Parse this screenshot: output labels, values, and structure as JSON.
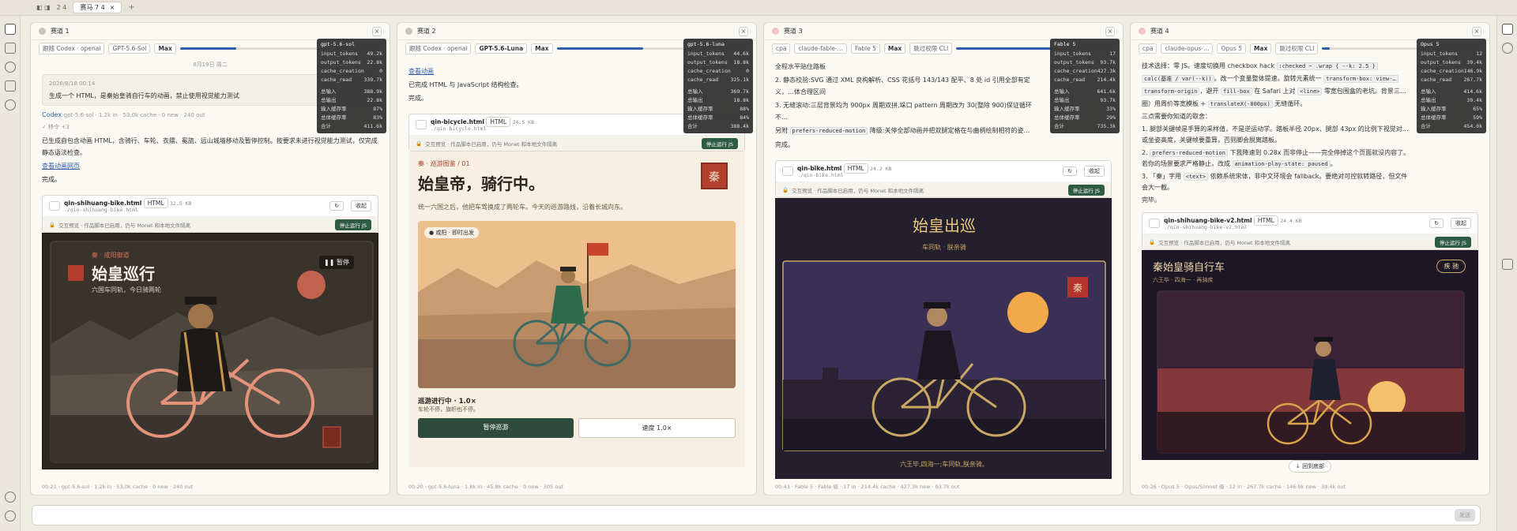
{
  "tabs": {
    "items": [
      "2 4"
    ],
    "active": "赛马 7 4"
  },
  "panels": [
    {
      "title": "赛道 1",
      "chips": [
        "跟随 Codex · openai",
        "GPT-5.6-Sol",
        "Max"
      ],
      "progress": 0.28,
      "stats": {
        "model": "gpt-5.6-sol",
        "rows": [
          [
            "input_tokens",
            "49.2k"
          ],
          [
            "output_tokens",
            "22.8k"
          ],
          [
            "cache_creation",
            "0"
          ],
          [
            "cache_read",
            "339.7k"
          ]
        ],
        "rows2": [
          [
            "总输入",
            "388.9k"
          ],
          [
            "总输出",
            "22.8k"
          ],
          [
            "输入缓存率",
            "87%"
          ],
          [
            "总体缓存率",
            "83%"
          ],
          [
            "合计",
            "411.6k"
          ]
        ]
      }
    },
    {
      "title": "赛道 2",
      "chips": [
        "跟随 Codex · openai",
        "GPT-5.6-Luna",
        "Max"
      ],
      "progress": 0.45,
      "stats": {
        "model": "gpt-5.6-luna",
        "rows": [
          [
            "input_tokens",
            "44.6k"
          ],
          [
            "output_tokens",
            "18.8k"
          ],
          [
            "cache_creation",
            "0"
          ],
          [
            "cache_read",
            "325.1k"
          ]
        ],
        "rows2": [
          [
            "总输入",
            "369.7k"
          ],
          [
            "总输出",
            "18.8k"
          ],
          [
            "输入缓存率",
            "88%"
          ],
          [
            "总体缓存率",
            "84%"
          ],
          [
            "合计",
            "388.4k"
          ]
        ]
      }
    },
    {
      "title": "赛道 3",
      "chips": [
        "cpa",
        "claude-fable-…",
        "Fable 5",
        "Max",
        "跳过权限 CLI"
      ],
      "progress": 0.6,
      "stats": {
        "model": "Fable 5",
        "rows": [
          [
            "input_tokens",
            "17"
          ],
          [
            "output_tokens",
            "93.7k"
          ],
          [
            "cache_creation",
            "427.3k"
          ],
          [
            "cache_read",
            "214.4k"
          ]
        ],
        "rows2": [
          [
            "总输入",
            "641.6k"
          ],
          [
            "总输出",
            "93.7k"
          ],
          [
            "输入缓存率",
            "33%"
          ],
          [
            "总体缓存率",
            "29%"
          ],
          [
            "合计",
            "735.3k"
          ]
        ]
      }
    },
    {
      "title": "赛道 4",
      "chips": [
        "cpa",
        "claude-opus-…",
        "Opus 5",
        "Max",
        "跳过权限 CLI"
      ],
      "progress": 0.05,
      "stats": {
        "model": "Opus 5",
        "rows": [
          [
            "input_tokens",
            "12"
          ],
          [
            "output_tokens",
            "39.4k"
          ],
          [
            "cache_creation",
            "146.9k"
          ],
          [
            "cache_read",
            "267.7k"
          ]
        ],
        "rows2": [
          [
            "总输入",
            "414.6k"
          ],
          [
            "总输出",
            "39.4k"
          ],
          [
            "输入缓存率",
            "65%"
          ],
          [
            "总体缓存率",
            "59%"
          ],
          [
            "合计",
            "454.0k"
          ]
        ]
      }
    }
  ],
  "p1": {
    "date": "8月19日 周二",
    "ts": "2026/8/18 00:14",
    "prompt": "生成一个 HTML，是秦始皇骑自行车的动画，禁止使用视觉能力测试",
    "agent": "Codex",
    "meta": "gpt-5.6-sol · 1.2k in · 53.0k cache · 0 new · 240 out",
    "steps": "✓ 移令 +3",
    "text": "已生成自包含动画 HTML，含骑行、车轮、衣摆、冕旒、远山城墙移动及暂停控制。按要求未进行视觉能力测试，仅完成静态语法检查。",
    "link": "查看动画网页",
    "done": "完成。",
    "file": {
      "name": "qin-shihuang-bike.html",
      "tag": "HTML",
      "size": "32.5 KB",
      "path": "./qin-shihuang-bike.html",
      "btn": "收起",
      "bar": "交互预览 · 作品脚本已启用，仍与 Monet 和本地文件隔离",
      "stop": "停止运行 JS"
    },
    "scene": {
      "tag": "秦 · 咸阳御道",
      "title": "始皇巡行",
      "sub": "六国车同轨，今日骑两轮",
      "pause": "暂停"
    },
    "foot": "00:21 · gpt-5.6-sol · 1.2k in · 53.0k cache · 0 new · 240 out"
  },
  "p2": {
    "link": "查看动画",
    "l1": "已完成 HTML 与 JavaScript 结构检查。",
    "l2": "完成。",
    "file": {
      "name": "qin-bicycle.html",
      "tag": "HTML",
      "size": "24.5 KB",
      "path": "./qin-bicycle.html",
      "bar": "交互预览 · 作品脚本已启用，仍与 Monet 和本地文件隔离",
      "stop": "停止运行 JS"
    },
    "scene": {
      "kicker": "秦 · 巡游图鉴 / 01",
      "title": "始皇帝，骑行中。",
      "seal": "秦",
      "desc": "统一六国之后，他把车驾换成了两轮车。今天的巡游路线，沿着长城向东。",
      "badge": "咸阳 · 即时出发",
      "status": "巡游进行中 · 1.0×",
      "status2": "车轮不停，旗帜也不停。",
      "btn1": "暂停巡游",
      "btn2": "速度 1.0×"
    },
    "foot": "00:20 · gpt-5.6-luna · 1.8k in · 45.8k cache · 0 new · 305 out"
  },
  "p3": {
    "l0": "全程水平贴住路板",
    "l1": "2. 静态校验:SVG 通过 XML 良构解析、CSS 花括号 143/143 配平、8 处 id 引用全部有定义，…体合理区间",
    "l2": "3. 无缝滚动:三层背景均为 900px 周期双拼,垛口 pattern 周期改为 30(整除 900)保证循环不…",
    "l3a": "另附",
    "code": "prefers-reduced-motion",
    "l3b": "降级:关停全部动画并把双腿定格在与曲柄绘制相符的姿…",
    "done": "完成。",
    "file": {
      "name": "qin-bike.html",
      "tag": "HTML",
      "size": "24.2 KB",
      "path": "./qin-bike.html",
      "btn": "收起",
      "bar": "交互预览 · 作品脚本已启用，仍与 Monet 和本地文件隔离",
      "stop": "停止运行 JS"
    },
    "scene": {
      "title": "始皇出巡",
      "sub": "车同轨 · 朕亲骑",
      "seal": "秦",
      "caption": "六王毕,四海一;车同轨,朕亲骑。"
    },
    "foot": "00:43 · Fable 5 · Fable 级 · 17 in · 214.4k cache · 427.3k new · 93.7k out"
  },
  "p4": {
    "l0": "技术选择：零 JS。速度切换用 checkbox hack",
    "l0c": ":checked ~ .wrap { --k: 2.5 }",
    "l1c": "calc(基准 / var(--k))",
    "l1": "。改一个变量整体提速。旋转元素统一",
    "l1c2": "transform-box: view-…",
    "l2c": "transform-origin",
    "l2": "，避开",
    "l2c2": "fill-box",
    "l2b": "在 Safari 上对",
    "l2c3": "<line>",
    "l2d": "零宽包围盒的老坑。背景三…",
    "l3": "圈）用周价等宽模板 +",
    "l3c": "translateX(-800px)",
    "l3b": "无缝循环。",
    "h": "三点需要你知道的取舍：",
    "i1": "1. 腿部关键帧是手算的采样值，不是逆运动学。踏板半径 20px、腿部 43px 的比例下视觉对…或坐姿高度，关键帧要重算，否则脚会脱离踏板。",
    "i2": "2.",
    "i2c": "prefers-reduced-motion",
    "i2b": "下我降速到 0.28x 而非停止——完全停掉这个页面就没内容了。若你的场景要求严格静止，改成",
    "i2c2": "animation-play-state: paused",
    "i2d": "。",
    "i3": "3. 「秦」字用",
    "i3c": "<text>",
    "i3b": "依赖系统宋体，非中文环境会 fallback。要绝对可控就转路径，但文件会大一截。",
    "done": "完毕。",
    "file": {
      "name": "qin-shihuang-bike-v2.html",
      "tag": "HTML",
      "size": "24.4 KB",
      "path": "./qin-shihuang-bike-v2.html",
      "btn": "收起",
      "bar": "交互预览 · 作品脚本已启用，仍与 Monet 和本地文件隔离",
      "stop": "停止运行 JS"
    },
    "scene": {
      "title": "秦始皇骑自行车",
      "sub": "六王毕 · 四海一 · 再骑疾",
      "speed": "疾 驰"
    },
    "back": "↓ 回到底部",
    "foot": "00:26 · Opus 5 · Opus/Sonnet 级 · 12 in · 267.7k cache · 146.9k new · 39.4k out"
  },
  "input": {
    "send": "发送"
  }
}
